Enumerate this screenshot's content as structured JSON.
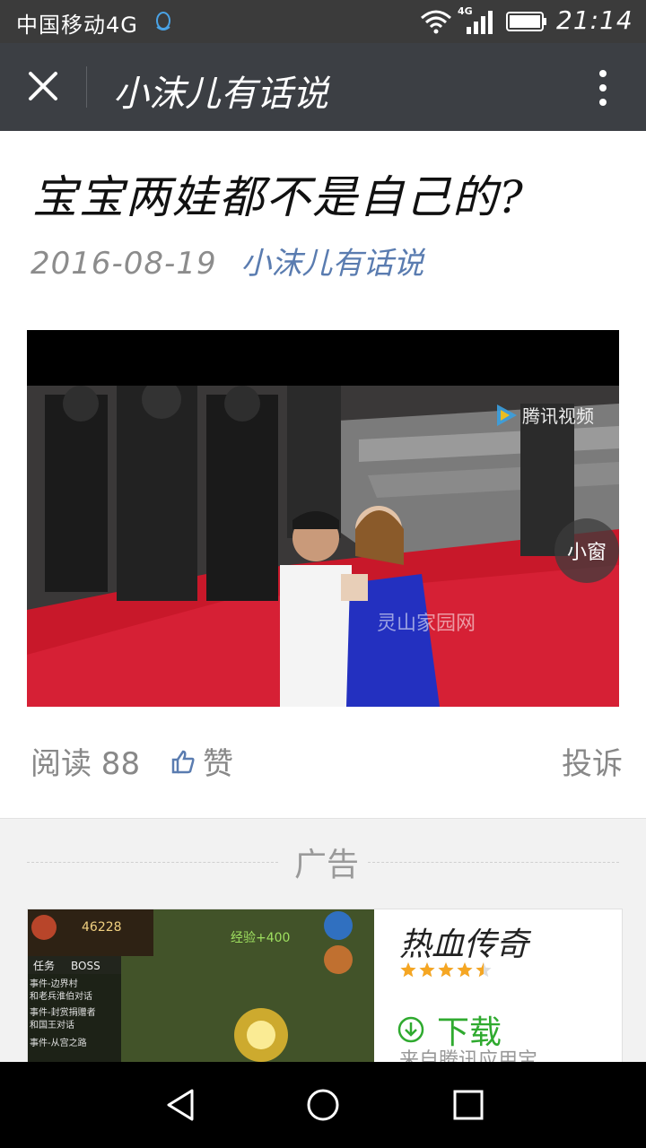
{
  "status_bar": {
    "carrier": "中国移动4G",
    "net_type": "4G",
    "time": "21:14",
    "icons": [
      "qq-icon",
      "wifi-icon",
      "signal-icon",
      "battery-icon"
    ]
  },
  "header": {
    "title": "小沫儿有话说",
    "close_icon": "close-icon",
    "more_icon": "more-vertical-icon"
  },
  "article": {
    "title": "宝宝两娃都不是自己的?",
    "date": "2016-08-19",
    "author": "小沫儿有话说"
  },
  "video": {
    "watermark": "腾讯视频",
    "mini_window_label": "小窗",
    "overlay_text": "灵山家园网"
  },
  "stats": {
    "reads": "阅读 88",
    "like_label": "赞",
    "report_label": "投诉"
  },
  "ad": {
    "label": "广告",
    "app_name": "热血传奇",
    "rating": 4.5,
    "download_label": "下载",
    "source": "来自腾讯应用宝",
    "thumb_text": {
      "player_level": "46228",
      "menu": [
        "任务",
        "BOSS"
      ],
      "quests": [
        "事件-边界村",
        "和老兵淮伯对话",
        "事件-封赏捐赠者",
        "和国王对话",
        "事件-从宫之路"
      ],
      "exp": "经验+400"
    }
  },
  "colors": {
    "header_bg": "#3c3f44",
    "status_bg": "#3b3b3b",
    "link": "#5a7cb0",
    "download_green": "#2faa2f",
    "star": "#f5a623"
  }
}
